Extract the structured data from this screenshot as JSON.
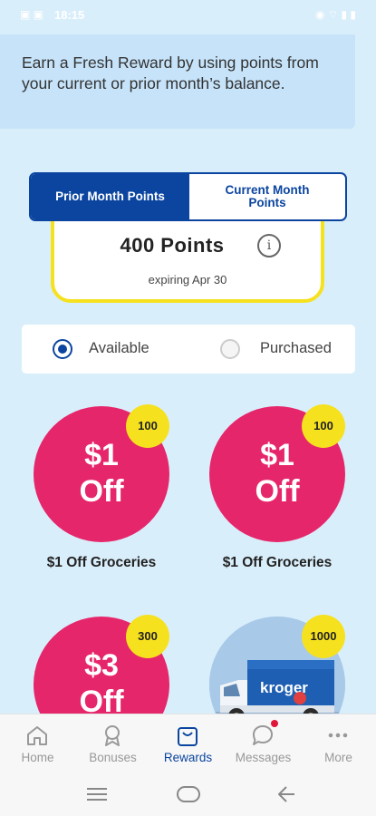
{
  "status_bar": {
    "time": "18:15"
  },
  "banner": {
    "text": "Earn a Fresh Reward by using points from your current or prior month’s balance."
  },
  "tabs": [
    {
      "label": "Prior Month Points",
      "active": true
    },
    {
      "label": "Current Month Points",
      "active": false
    }
  ],
  "points": {
    "value": "400 Points",
    "expiry": "expiring Apr 30"
  },
  "filter": {
    "options": [
      "Available",
      "Purchased"
    ],
    "selected": "Available"
  },
  "rewards": [
    {
      "amount": "$1",
      "off": "Off",
      "points": "100",
      "name": "$1 Off Groceries"
    },
    {
      "amount": "$1",
      "off": "Off",
      "points": "100",
      "name": "$1 Off Groceries"
    },
    {
      "amount": "$3",
      "off": "Off",
      "points": "300",
      "name": ""
    },
    {
      "amount": "",
      "off": "",
      "points": "1000",
      "name": "",
      "image": "kroger-delivery-truck",
      "image_text": "kroger"
    }
  ],
  "bottom_nav": [
    {
      "label": "Home",
      "icon": "home-icon"
    },
    {
      "label": "Bonuses",
      "icon": "ribbon-icon"
    },
    {
      "label": "Rewards",
      "icon": "bag-icon",
      "active": true
    },
    {
      "label": "Messages",
      "icon": "chat-bubble-icon",
      "notification": true
    },
    {
      "label": "More",
      "icon": "more-dots-icon"
    }
  ],
  "colors": {
    "brand_blue": "#0b45a0",
    "reward_pink": "#e6266a",
    "badge_yellow": "#f6e11f",
    "background": "#d9eefb"
  }
}
